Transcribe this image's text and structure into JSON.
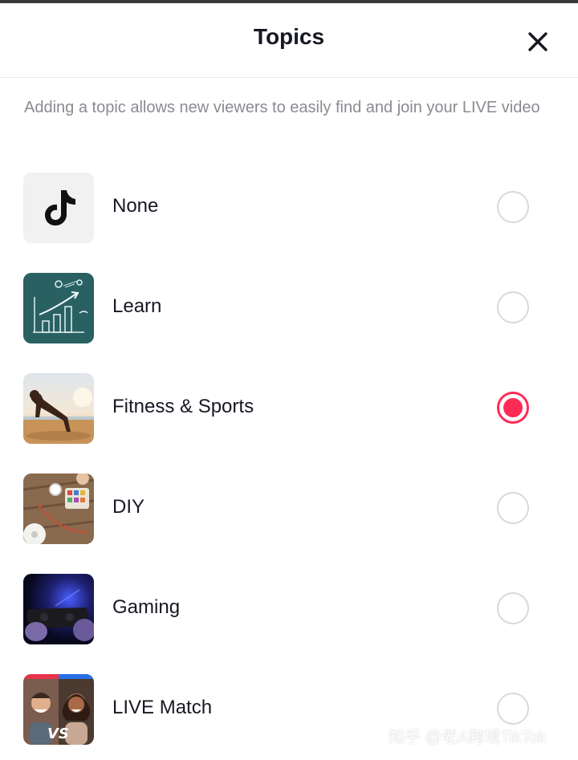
{
  "header": {
    "title": "Topics",
    "close_icon": "close-icon"
  },
  "description": "Adding a topic allows new viewers to easily find and join your LIVE video",
  "topics": [
    {
      "label": "None",
      "icon": "tiktok-logo-icon",
      "selected": false
    },
    {
      "label": "Learn",
      "icon": "learn-thumbnail",
      "selected": false
    },
    {
      "label": "Fitness & Sports",
      "icon": "fitness-thumbnail",
      "selected": true
    },
    {
      "label": "DIY",
      "icon": "diy-thumbnail",
      "selected": false
    },
    {
      "label": "Gaming",
      "icon": "gaming-thumbnail",
      "selected": false
    },
    {
      "label": "LIVE Match",
      "icon": "live-match-thumbnail",
      "selected": false
    }
  ],
  "colors": {
    "accent": "#fe2c55",
    "text": "#161823",
    "muted": "#8a8b91"
  },
  "watermark": "知乎 @老A跨境TikTok"
}
